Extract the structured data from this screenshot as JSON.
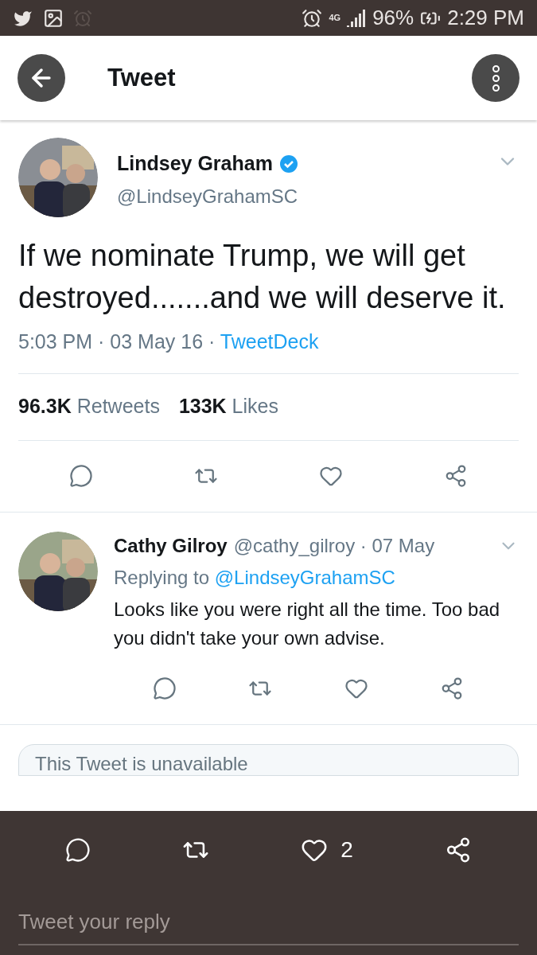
{
  "status_bar": {
    "network": "4G",
    "battery": "96%",
    "time": "2:29 PM"
  },
  "header": {
    "title": "Tweet"
  },
  "tweet": {
    "name": "Lindsey Graham",
    "verified": true,
    "handle": "@LindseyGrahamSC",
    "text": "If we nominate Trump, we will get destroyed.......and we will deserve it.",
    "time": "5:03 PM · 03 May 16 · ",
    "source": "TweetDeck",
    "stats": [
      {
        "count": "96.3K",
        "label": "Retweets"
      },
      {
        "count": "133K",
        "label": "Likes"
      }
    ]
  },
  "reply": {
    "name": "Cathy Gilroy",
    "handle": "@cathy_gilroy · 07 May",
    "replying_prefix": "Replying to ",
    "replying_to": "@LindseyGrahamSC",
    "text": "Looks like you were right all the time. Too bad you didn't take your own advise."
  },
  "quoted_card": {
    "text": "This Tweet is unavailable"
  },
  "bottom_bar": {
    "like_count": "2",
    "reply_field": {
      "placeholder": "Tweet your reply"
    }
  }
}
